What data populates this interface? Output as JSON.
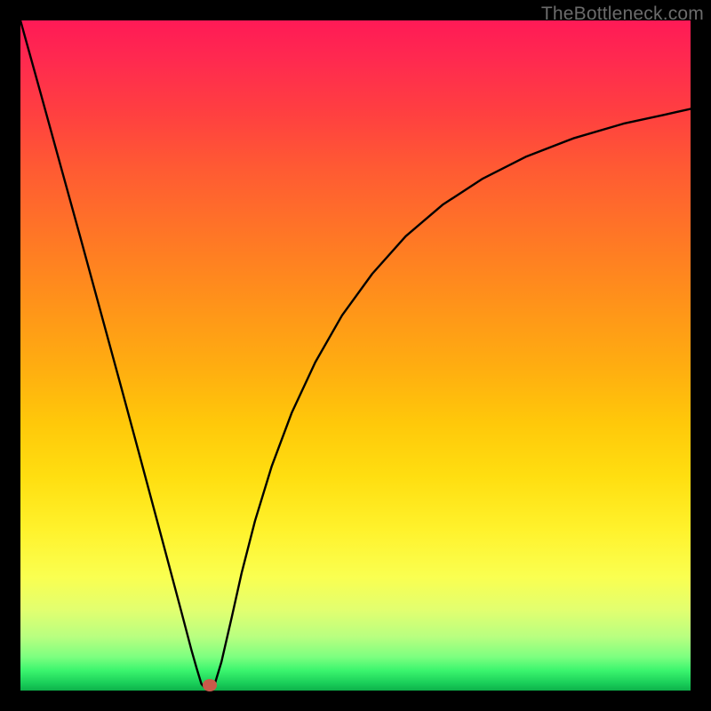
{
  "watermark": "TheBottleneck.com",
  "marker": {
    "x_frac": 0.283,
    "y_frac": 0.992,
    "color": "#c85a4a"
  },
  "chart_data": {
    "type": "line",
    "title": "",
    "xlabel": "",
    "ylabel": "",
    "xlim": [
      0,
      1
    ],
    "ylim": [
      0,
      1
    ],
    "x": [
      0.0,
      0.03,
      0.06,
      0.09,
      0.12,
      0.15,
      0.18,
      0.21,
      0.24,
      0.255,
      0.263,
      0.27,
      0.275,
      0.28,
      0.29,
      0.3,
      0.315,
      0.33,
      0.35,
      0.375,
      0.405,
      0.44,
      0.48,
      0.525,
      0.575,
      0.63,
      0.69,
      0.755,
      0.825,
      0.9,
      0.96,
      1.0
    ],
    "y": [
      1.0,
      0.892,
      0.783,
      0.674,
      0.564,
      0.454,
      0.343,
      0.231,
      0.118,
      0.061,
      0.033,
      0.01,
      0.004,
      0.003,
      0.01,
      0.043,
      0.108,
      0.175,
      0.253,
      0.335,
      0.415,
      0.49,
      0.56,
      0.622,
      0.678,
      0.725,
      0.764,
      0.797,
      0.824,
      0.846,
      0.859,
      0.868
    ],
    "series": [
      {
        "name": "bottleneck-curve",
        "stroke": "#000000",
        "stroke_width": 2.4
      }
    ],
    "background_gradient": {
      "direction": "top-to-bottom",
      "stops": [
        {
          "pos": 0.0,
          "color": "#ff1a56"
        },
        {
          "pos": 0.5,
          "color": "#ffae10"
        },
        {
          "pos": 0.8,
          "color": "#fff22c"
        },
        {
          "pos": 1.0,
          "color": "#0eb14a"
        }
      ]
    },
    "marker": {
      "x": 0.283,
      "y": 0.008,
      "color": "#c85a4a"
    }
  }
}
